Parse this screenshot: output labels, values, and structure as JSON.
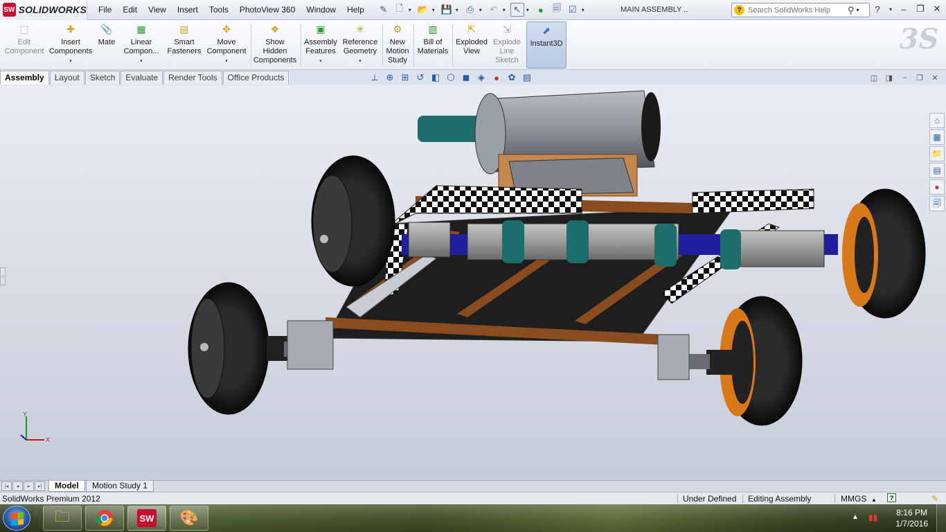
{
  "app": {
    "brand": "SOLIDWORKS",
    "document_title": "MAIN ASSEMBLY ..",
    "menus": [
      "File",
      "Edit",
      "View",
      "Insert",
      "Tools",
      "PhotoView 360",
      "Window",
      "Help"
    ],
    "search_placeholder": "Search SolidWorks Help"
  },
  "commands": [
    {
      "label": "Edit Component",
      "icon": "edit-component-icon",
      "enabled": false
    },
    {
      "label": "Insert Components",
      "icon": "insert-components-icon",
      "enabled": true
    },
    {
      "label": "Mate",
      "icon": "mate-icon",
      "enabled": true
    },
    {
      "label": "Linear Compon...",
      "icon": "linear-pattern-icon",
      "enabled": true
    },
    {
      "label": "Smart Fasteners",
      "icon": "smart-fasteners-icon",
      "enabled": true
    },
    {
      "label": "Move Component",
      "icon": "move-component-icon",
      "enabled": true
    },
    {
      "label": "Show Hidden Components",
      "icon": "show-hidden-icon",
      "enabled": true
    },
    {
      "label": "Assembly Features",
      "icon": "assembly-features-icon",
      "enabled": true
    },
    {
      "label": "Reference Geometry",
      "icon": "reference-geometry-icon",
      "enabled": true
    },
    {
      "label": "New Motion Study",
      "icon": "motion-study-icon",
      "enabled": true
    },
    {
      "label": "Bill of Materials",
      "icon": "bom-icon",
      "enabled": true
    },
    {
      "label": "Exploded View",
      "icon": "exploded-view-icon",
      "enabled": true
    },
    {
      "label": "Explode Line Sketch",
      "icon": "explode-line-icon",
      "enabled": false
    },
    {
      "label": "Instant3D",
      "icon": "instant3d-icon",
      "enabled": true
    }
  ],
  "tabs": [
    "Assembly",
    "Layout",
    "Sketch",
    "Evaluate",
    "Render Tools",
    "Office Products"
  ],
  "active_tab": "Assembly",
  "triad": {
    "x": "X",
    "y": "Y"
  },
  "bottom_tabs": [
    "Model",
    "Motion Study 1"
  ],
  "status": {
    "product": "SolidWorks Premium 2012",
    "definition": "Under Defined",
    "mode": "Editing Assembly",
    "units": "MMGS",
    "units_arrow": "▲"
  },
  "taskbar": {
    "time": "8:16 PM",
    "date": "1/7/2016"
  },
  "colors": {
    "accent": "#c8102e",
    "tire": "#1b1b1b",
    "rim_orange": "#d9781a",
    "frame_wood": "#8a4b1e",
    "shaft_blue": "#1f1fa0",
    "teal": "#1d6d6a"
  }
}
